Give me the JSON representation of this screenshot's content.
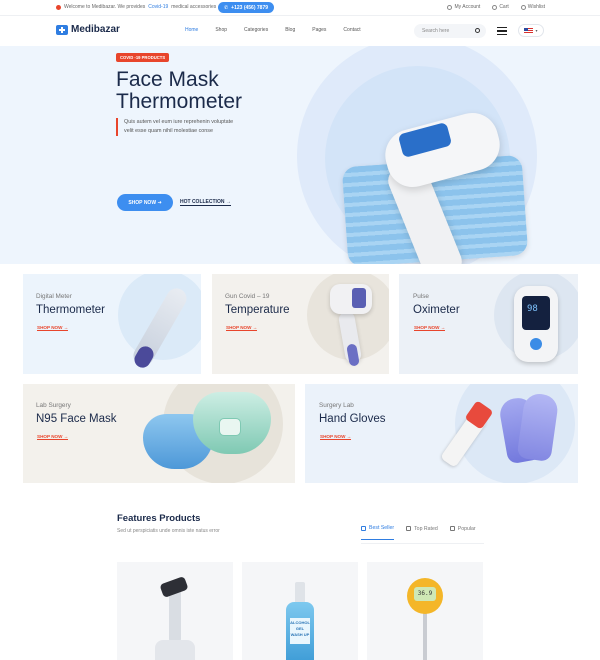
{
  "topbar": {
    "welcome_prefix": "Welcome to Medibazar. We provides",
    "welcome_highlight": "Covid-19",
    "welcome_suffix": "medical accessories",
    "phone": "+123 (456) 7879",
    "my_account": "My Account",
    "cart": "Cart",
    "wishlist": "Wishlist"
  },
  "header": {
    "logo": "Medibazar",
    "nav": [
      "Home",
      "Shop",
      "Categories",
      "Blog",
      "Pages",
      "Contact"
    ],
    "active_nav": "Home",
    "search_placeholder": "Search here"
  },
  "hero": {
    "badge": "COVID -19 PRODUCTS",
    "title_line1": "Face Mask",
    "title_line2": "Thermometer",
    "desc_line1": "Quis autem vel eum iure reprehenin voluptate",
    "desc_line2": "velit esse quam nihil molestiae conse",
    "shop_button": "SHOP NOW",
    "hot_collection": "HOT COLLECTION"
  },
  "categories": [
    {
      "sub": "Digital Meter",
      "title": "Thermometer",
      "link": "SHOP NOW"
    },
    {
      "sub": "Gun Covid – 19",
      "title": "Temperature",
      "link": "SHOP NOW"
    },
    {
      "sub": "Pulse",
      "title": "Oximeter",
      "link": "SHOP NOW",
      "display_value": "98"
    },
    {
      "sub": "Lab Surgery",
      "title": "N95 Face Mask",
      "link": "SHOP NOW"
    },
    {
      "sub": "Surgery Lab",
      "title": "Hand Gloves",
      "link": "SHOP NOW"
    }
  ],
  "features": {
    "title": "Features Products",
    "subtitle": "Sed ut perspiciatis unde omnis iste natus error",
    "tabs": [
      "Best Seller",
      "Top Rated",
      "Popular"
    ],
    "active_tab": "Best Seller"
  },
  "products": [
    {
      "name": "microscope"
    },
    {
      "name": "gel-bottle",
      "label": "ALCOHOL GEL WASH UP"
    },
    {
      "name": "pin-thermometer",
      "display": "36.9"
    }
  ],
  "colors": {
    "accent": "#3d8ef0",
    "badge_red": "#e8452c",
    "navy": "#1b2a4a"
  }
}
